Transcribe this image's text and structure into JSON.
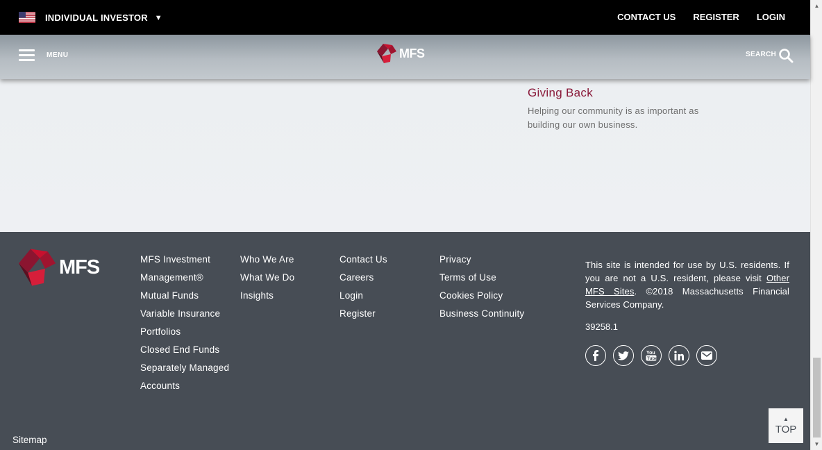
{
  "topbar": {
    "investor_label": "INDIVIDUAL INVESTOR",
    "caret": "▼",
    "links": [
      "CONTACT US",
      "REGISTER",
      "LOGIN"
    ]
  },
  "header": {
    "menu_label": "MENU",
    "logo_text": "MFS",
    "search_label": "SEARCH"
  },
  "content": {
    "giving_back_title": "Giving Back",
    "giving_back_text": "Helping our community is as important as building our own business."
  },
  "footer": {
    "logo_text": "MFS",
    "col1": [
      "MFS Investment Management®",
      "Mutual Funds",
      "Variable Insurance Portfolios",
      "Closed End Funds",
      "Separately Managed Accounts"
    ],
    "col2": [
      "Who We Are",
      "What We Do",
      "Insights"
    ],
    "col3": [
      "Contact Us",
      "Careers",
      "Login",
      "Register"
    ],
    "col4": [
      "Privacy",
      "Terms of Use",
      "Cookies Policy",
      "Business Continuity"
    ],
    "disclaimer_pre": "This site is intended for use by U.S. residents. If you are not a U.S. resident, please visit ",
    "disclaimer_link": "Other MFS Sites",
    "disclaimer_post": ". ©2018 Massachusetts Financial Services Company.",
    "code": "39258.1",
    "social": [
      "facebook-icon",
      "twitter-icon",
      "youtube-icon",
      "linkedin-icon",
      "email-icon"
    ],
    "sitemap": "Sitemap",
    "top_label": "TOP"
  },
  "colors": {
    "accent": "#8a1a3a",
    "logo_red": "#c8102e",
    "footer_bg": "#474d55"
  }
}
